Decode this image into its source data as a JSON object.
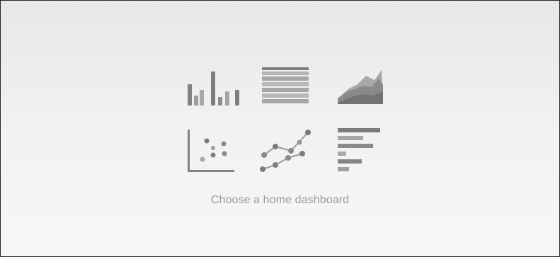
{
  "empty_state": {
    "caption": "Choose a home dashboard",
    "icons": [
      "bar-chart-icon",
      "table-icon",
      "area-chart-icon",
      "scatter-plot-icon",
      "line-chart-icon",
      "horizontal-bar-chart-icon"
    ]
  },
  "colors": {
    "border": "#262626",
    "caption": "#9a9a9a",
    "icon_dark": "#7a7a7a",
    "icon_light": "#a9a9a9"
  }
}
